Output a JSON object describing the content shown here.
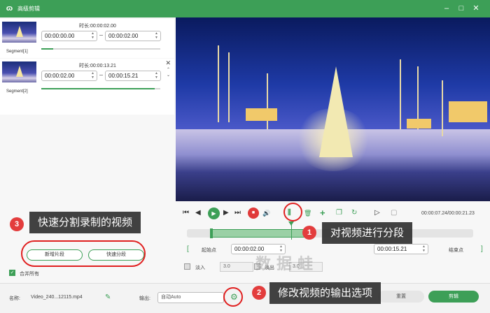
{
  "window": {
    "logo": "ɷ",
    "title": "高级剪辑",
    "controls": [
      "–",
      "□",
      "✕"
    ]
  },
  "segments": [
    {
      "name": "Segment[1]",
      "duration_label": "时长:",
      "duration": "00:00:02.00",
      "start": "00:00:00.00",
      "end": "00:00:02.00",
      "progress": 0.1
    },
    {
      "name": "Segment[2]",
      "duration_label": "时长:",
      "duration": "00:00:13.21",
      "start": "00:00:02.00",
      "end": "00:00:15.21",
      "progress": 0.95,
      "close": "✕",
      "up": "⌃",
      "down": "⌄"
    }
  ],
  "left_actions": {
    "new_segment": "新增片段",
    "quick_split": "快速分段",
    "merge_all": "合并所有",
    "merge_checked": "✓"
  },
  "player": {
    "timecode": "00:00:07.24/00:00:21.23",
    "icons": {
      "prev": "⏮",
      "rewind": "◀",
      "play": "▶",
      "forward": "▶",
      "next": "⏭",
      "stop": "■",
      "volume": "🔊",
      "split": "⫼",
      "delete": "🗑",
      "add": "+",
      "copy": "❐",
      "reset": "↻",
      "frame_prev": "▷",
      "frame_next": "▢"
    },
    "track_selection": 0.33,
    "playhead": 0.4
  },
  "range": {
    "start_label": "起始点",
    "start_time": "00:00:02.00",
    "end_time": "00:00:15.21",
    "end_label": "结束点",
    "bracket_left": "[",
    "bracket_right": "]"
  },
  "fade": {
    "fade_in_label": "淡入",
    "fade_in_value": "3.0",
    "fade_out_label": "淡出",
    "fade_out_value": "3.0"
  },
  "bottom": {
    "name_label": "名称:",
    "file_name": "Video_240...12115.mp4",
    "edit_icon": "✎",
    "output_label": "输出:",
    "output_value": "自动Auto",
    "settings_icon": "⚙",
    "reset_label": "重置",
    "cut_label": "剪辑"
  },
  "annotations": [
    {
      "num": "1",
      "text": "对视频进行分段"
    },
    {
      "num": "2",
      "text": "修改视频的输出选项"
    },
    {
      "num": "3",
      "text": "快速分割录制的视频"
    }
  ],
  "watermark": "数据蛙"
}
